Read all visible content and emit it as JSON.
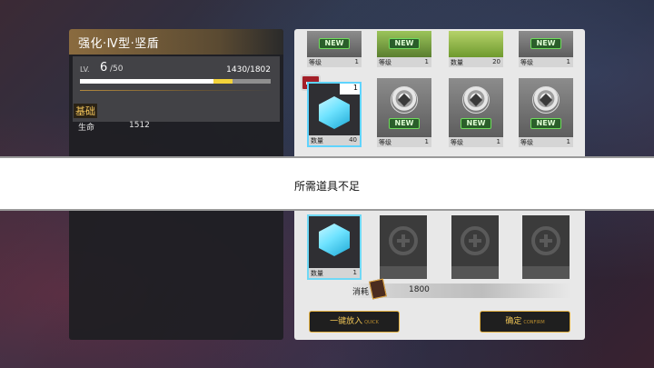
{
  "left": {
    "title": "强化·Ⅳ型·坚盾",
    "lv_label": "LV.",
    "lv_value": "6",
    "lv_max": "/50",
    "exp_text": "1430/1802",
    "exp_fraction": 0.7,
    "exp_gain_fraction": 0.1,
    "section": "基础",
    "hp_label": "生命",
    "hp_value": "1512"
  },
  "top_items": [
    {
      "label": "等级",
      "value": "1",
      "new_tag": "NEW"
    },
    {
      "label": "等级",
      "value": "1",
      "new_tag": "NEW"
    },
    {
      "label": "数量",
      "value": "20",
      "new_tag": ""
    },
    {
      "label": "等级",
      "value": "1",
      "new_tag": "NEW"
    }
  ],
  "mid_items": [
    {
      "label": "数量",
      "value": "40",
      "badge": "1"
    },
    {
      "label": "等级",
      "value": "1",
      "new_tag": "NEW"
    },
    {
      "label": "等级",
      "value": "1",
      "new_tag": "NEW"
    },
    {
      "label": "等级",
      "value": "1",
      "new_tag": "NEW"
    }
  ],
  "selected_item": {
    "label": "数量",
    "value": "1"
  },
  "cost": {
    "label": "消耗",
    "value": "1800"
  },
  "buttons": {
    "quick": "一键放入",
    "quick_sub": "QUICK",
    "confirm": "确定",
    "confirm_sub": "CONFIRM"
  },
  "toast": {
    "text": "所需道具不足"
  },
  "colors": {
    "accent": "#f1c656",
    "cube": "#6fe3ff",
    "toast_bg": "#ffffff"
  }
}
